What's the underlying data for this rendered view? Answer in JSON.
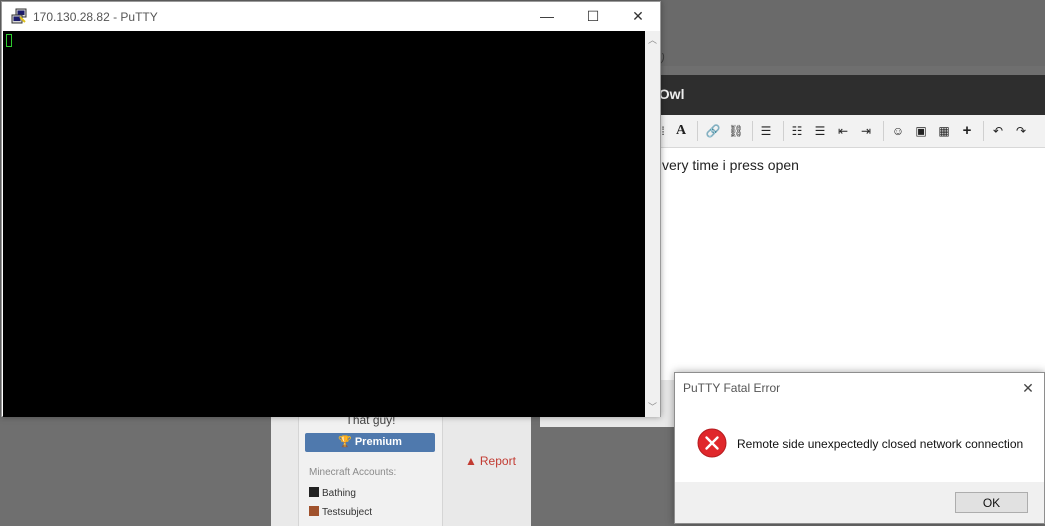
{
  "background": {
    "tab_text": "(s)",
    "user_title": "That guy!",
    "premium_label": "Premium",
    "minecraft_accounts_label": "Minecraft Accounts:",
    "accounts": [
      "Bathing",
      "Testsubject"
    ],
    "report_label": "Report"
  },
  "editor": {
    "title_fragment": "yOwl",
    "body_text": "very time i press open"
  },
  "putty": {
    "title": "170.130.28.82 - PuTTY",
    "minimize_glyph": "—",
    "maximize_glyph": "☐",
    "close_glyph": "✕"
  },
  "dialog": {
    "title": "PuTTY Fatal Error",
    "message": "Remote side unexpectedly closed network connection",
    "ok_label": "OK",
    "close_glyph": "✕"
  },
  "colors": {
    "terminal_bg": "#000000",
    "cursor": "#2fcb2f",
    "error_red": "#e0272b",
    "premium_blue": "#4f79ad"
  }
}
